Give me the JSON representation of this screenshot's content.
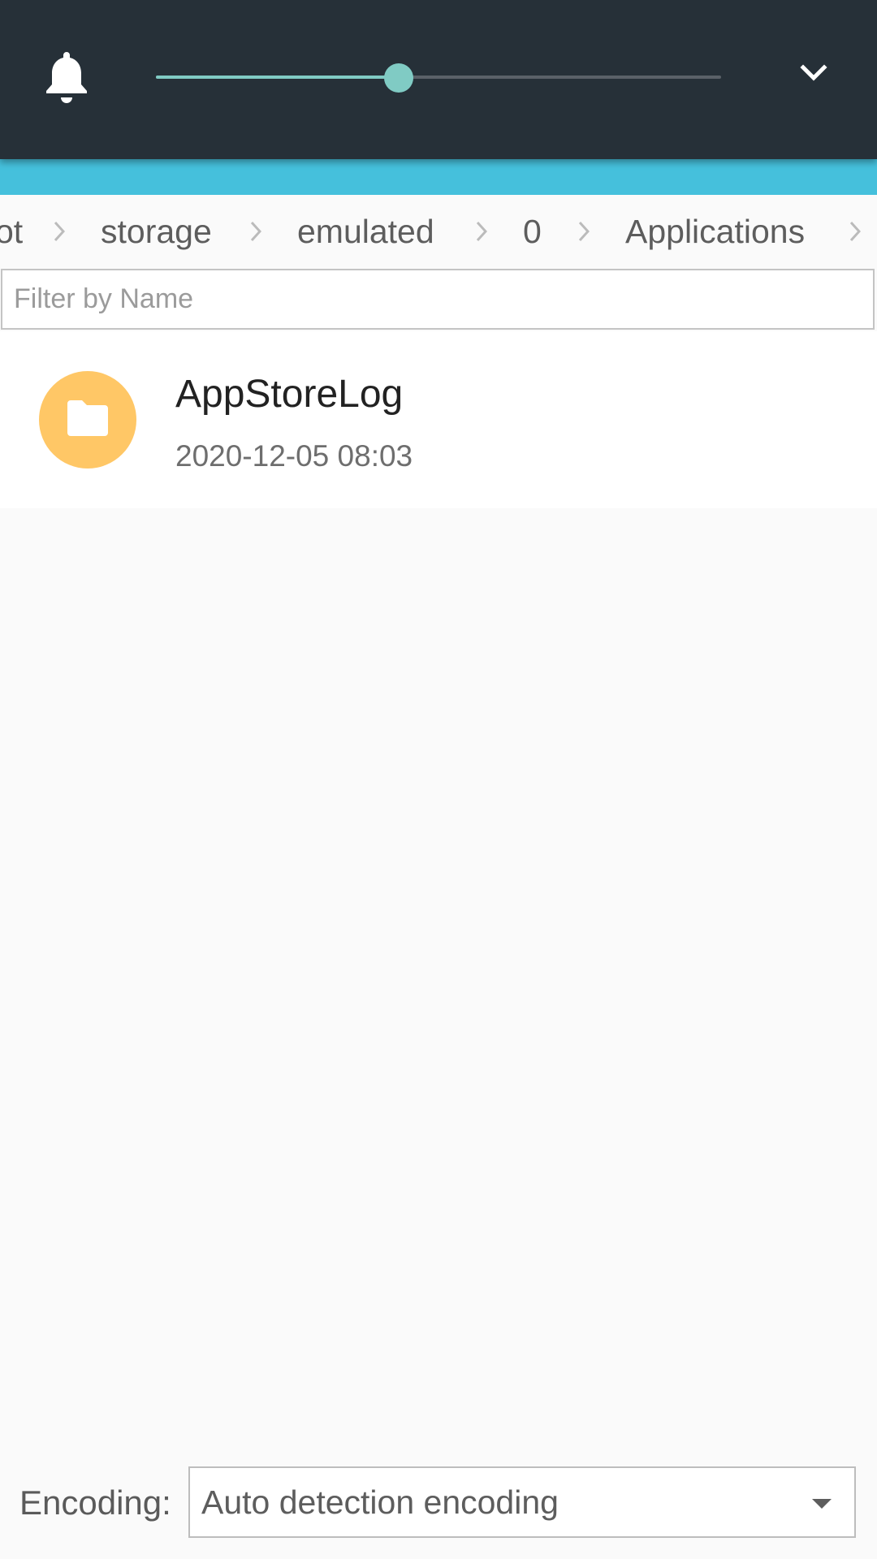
{
  "volume_panel": {
    "bell_icon": "bell-icon",
    "slider_level": 0.43,
    "expand_icon": "chevron-down-icon",
    "accent_color": "#80cbc4",
    "background_color": "#263038"
  },
  "app_bar": {
    "color": "#45c0dc"
  },
  "breadcrumb": {
    "items": [
      "ot",
      "storage",
      "emulated",
      "0",
      "Applications"
    ],
    "separator_icon": "chevron-right-icon"
  },
  "filter": {
    "placeholder": "Filter by Name",
    "value": ""
  },
  "files": [
    {
      "name": "AppStoreLog",
      "date": "2020-12-05 08:03",
      "icon": "folder-icon",
      "icon_color": "#ffc766"
    }
  ],
  "encoding": {
    "label": "Encoding:",
    "selected": "Auto detection encoding",
    "dropdown_icon": "caret-down-icon"
  }
}
